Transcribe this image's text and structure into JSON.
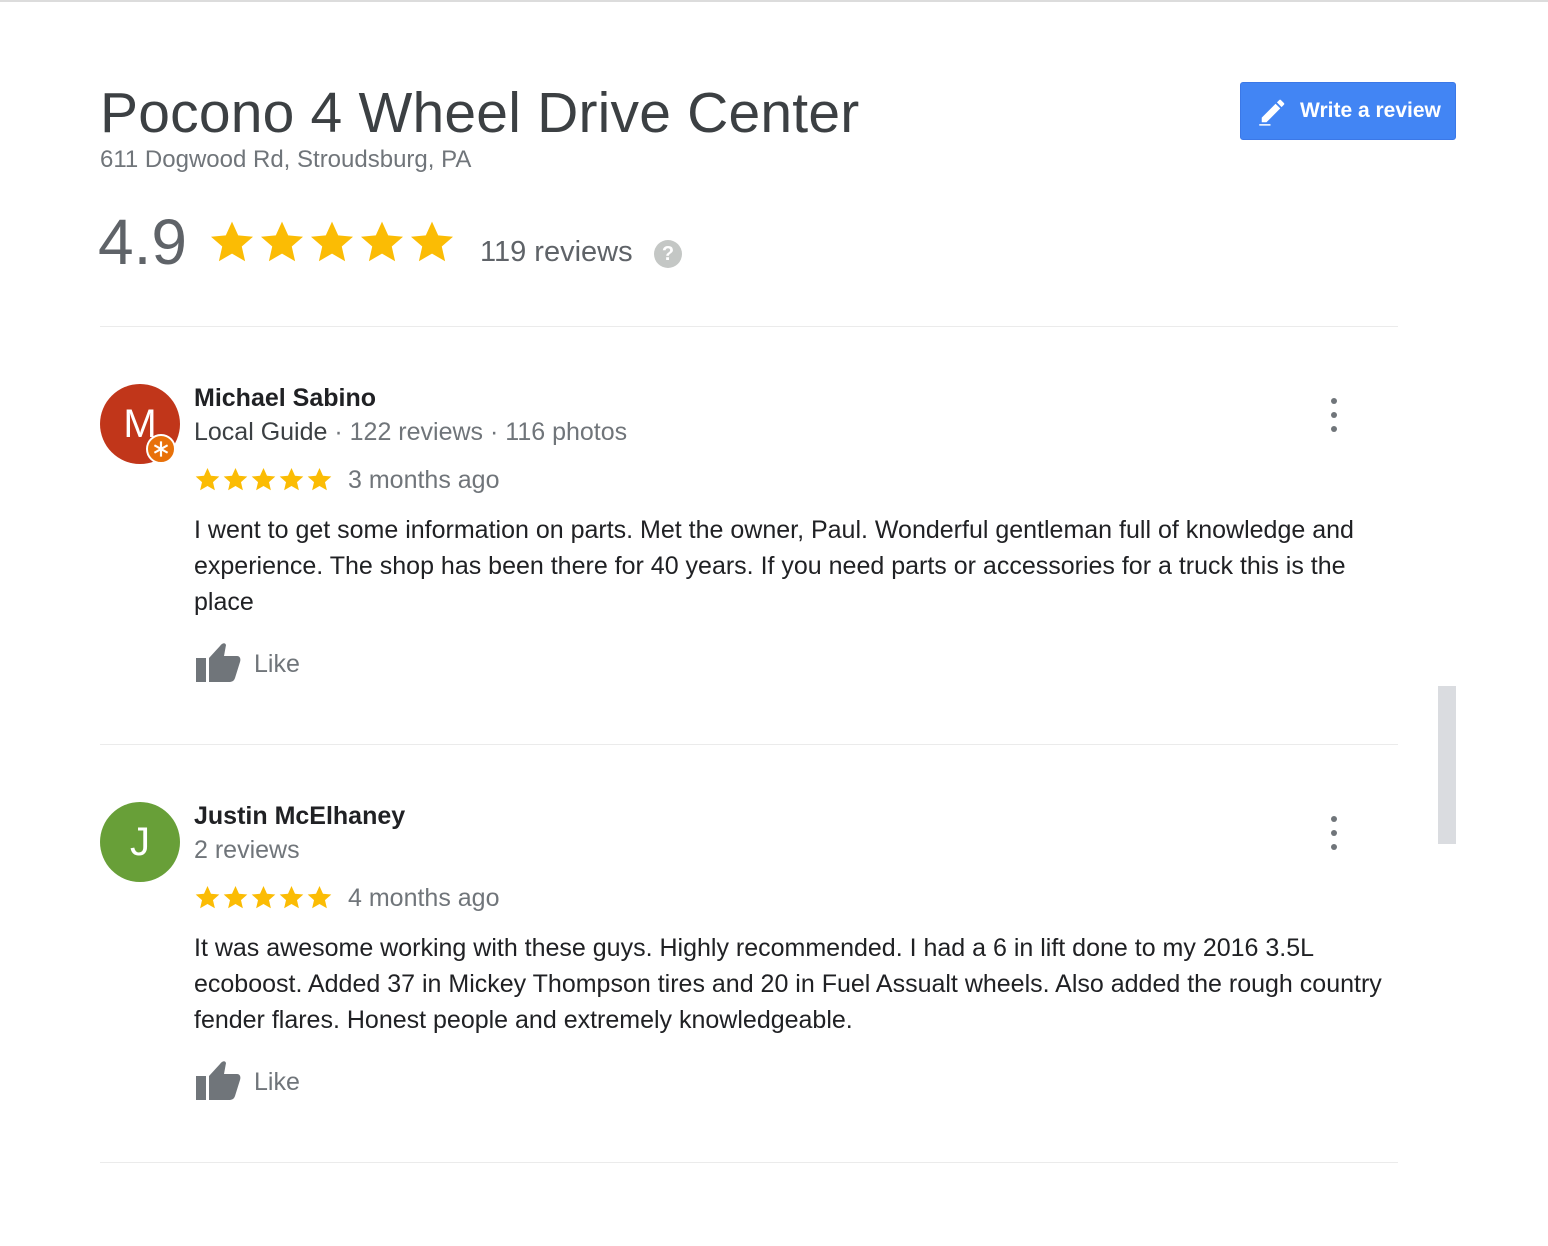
{
  "place": {
    "title": "Pocono 4 Wheel Drive Center",
    "address": "611 Dogwood Rd, Stroudsburg, PA",
    "write_review_label": "Write a review"
  },
  "summary": {
    "rating": "4.9",
    "stars": 5,
    "review_count": "119 reviews",
    "help_glyph": "?"
  },
  "reviews": [
    {
      "avatar_letter": "M",
      "avatar_color": "#c1361a",
      "name": "Michael Sabino",
      "guide_label": "Local Guide",
      "stats": " · 122 reviews · 116 photos",
      "stars": 5,
      "date": "3 months ago",
      "text": "I went to get some information on parts. Met the owner, Paul. Wonderful gentleman full of knowledge and experience. The shop has been there for 40 years. If you need parts or accessories for a truck this is the place",
      "like_label": "Like"
    },
    {
      "avatar_letter": "J",
      "avatar_color": "#689f38",
      "name": "Justin McElhaney",
      "guide_label": "",
      "stats": "2 reviews",
      "stars": 5,
      "date": "4 months ago",
      "text": "It was awesome working with these guys. Highly recommended. I had a 6 in lift done to my 2016 3.5L ecoboost. Added 37 in Mickey Thompson tires and 20 in Fuel Assualt wheels. Also added the rough country fender flares. Honest people and extremely knowledgeable.",
      "like_label": "Like"
    }
  ],
  "colors": {
    "star": "#fbbc04",
    "button": "#4285f4",
    "local_guide_badge": "#e8710a"
  },
  "icons": [
    "pencil-icon",
    "star-icon",
    "help-icon",
    "more-vert-icon",
    "thumbs-up-icon",
    "local-guide-badge-icon"
  ]
}
